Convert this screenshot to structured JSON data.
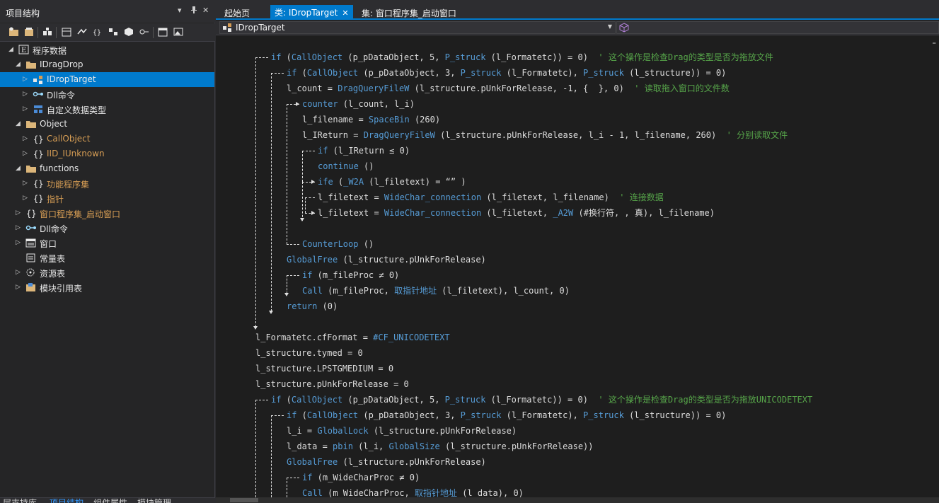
{
  "panel": {
    "title": "项目结构",
    "pin_glyph": "▾",
    "pushpin_glyph": "ꟷ",
    "close_glyph": "✕"
  },
  "tree": [
    {
      "label": "程序数据",
      "level": 0,
      "twist": "◢",
      "icon": "module-e-icon",
      "color": "white"
    },
    {
      "label": "IDragDrop",
      "level": 1,
      "twist": "◢",
      "icon": "folder-icon",
      "color": "white"
    },
    {
      "label": "IDropTarget",
      "level": 2,
      "twist": "▷",
      "icon": "class-icon",
      "color": "white",
      "selected": true
    },
    {
      "label": "Dll命令",
      "level": 2,
      "twist": "▷",
      "icon": "dll-icon",
      "color": "white"
    },
    {
      "label": "自定义数据类型",
      "level": 2,
      "twist": "▷",
      "icon": "datatype-icon",
      "color": "white"
    },
    {
      "label": "Object",
      "level": 1,
      "twist": "◢",
      "icon": "folder-icon",
      "color": "white"
    },
    {
      "label": "CallObject",
      "level": 2,
      "twist": "▷",
      "icon": "braces-icon",
      "color": "orange"
    },
    {
      "label": "IID_IUnknown",
      "level": 2,
      "twist": "▷",
      "icon": "braces-icon",
      "color": "orange"
    },
    {
      "label": "functions",
      "level": 1,
      "twist": "◢",
      "icon": "folder-icon",
      "color": "white"
    },
    {
      "label": "功能程序集",
      "level": 2,
      "twist": "▷",
      "icon": "braces-icon",
      "color": "orange"
    },
    {
      "label": "指针",
      "level": 2,
      "twist": "▷",
      "icon": "braces-icon",
      "color": "orange"
    },
    {
      "label": "窗口程序集_启动窗口",
      "level": 1,
      "twist": "▷",
      "icon": "braces-icon",
      "color": "orange",
      "shift": -1
    },
    {
      "label": "Dll命令",
      "level": 1,
      "twist": "▷",
      "icon": "dll-icon",
      "color": "white",
      "shift": -1
    },
    {
      "label": "窗口",
      "level": 1,
      "twist": "▷",
      "icon": "window-icon",
      "color": "white",
      "shift": -1
    },
    {
      "label": "常量表",
      "level": 1,
      "twist": "",
      "icon": "constants-icon",
      "color": "white",
      "shift": -1
    },
    {
      "label": "资源表",
      "level": 1,
      "twist": "▷",
      "icon": "resources-icon",
      "color": "white",
      "shift": -1
    },
    {
      "label": "模块引用表",
      "level": 1,
      "twist": "▷",
      "icon": "module-ref-icon",
      "color": "white",
      "shift": -1
    }
  ],
  "bottom_tabs": [
    {
      "label": "层支持库",
      "active": false
    },
    {
      "label": "项目结构",
      "active": true
    },
    {
      "label": "组件属性",
      "active": false
    },
    {
      "label": "模块管理",
      "active": false
    }
  ],
  "doc_tabs": [
    {
      "label": "起始页",
      "active": false
    },
    {
      "label": "类: IDropTarget",
      "active": true,
      "close": "✕"
    },
    {
      "label": "集: 窗口程序集_启动窗口",
      "active": false
    }
  ],
  "nav": {
    "class_combo": "IDropTarget",
    "arrow": "▼"
  },
  "right_mark": "⁼",
  "code_lines": [
    [
      [
        "kw",
        "if"
      ],
      [
        "op",
        " ("
      ],
      [
        "kw",
        "CallObject"
      ],
      [
        "op",
        " (p_pDataObject, 5, "
      ],
      [
        "kw",
        "P_struck"
      ],
      [
        "op",
        " (l_Formatetc)) = 0)  "
      ],
      [
        "cm",
        "' 这个操作是检查Drag的类型是否为拖放文件"
      ]
    ],
    [
      [
        "kw",
        "if"
      ],
      [
        "op",
        " ("
      ],
      [
        "kw",
        "CallObject"
      ],
      [
        "op",
        " (p_pDataObject, 3, "
      ],
      [
        "kw",
        "P_struck"
      ],
      [
        "op",
        " (l_Formatetc), "
      ],
      [
        "kw",
        "P_struck"
      ],
      [
        "op",
        " (l_structure)) = 0)"
      ]
    ],
    [
      [
        "var",
        "l_count = "
      ],
      [
        "kw",
        "DragQueryFileW"
      ],
      [
        "op",
        " (l_structure.pUnkForRelease, -1, {  }, 0)  "
      ],
      [
        "cm",
        "' 读取拖入窗口的文件数"
      ]
    ],
    [
      [
        "kw",
        "counter"
      ],
      [
        "op",
        " (l_count, l_i)"
      ]
    ],
    [
      [
        "var",
        "l_filename = "
      ],
      [
        "kw",
        "SpaceBin"
      ],
      [
        "op",
        " (260)"
      ]
    ],
    [
      [
        "var",
        "l_IReturn = "
      ],
      [
        "kw",
        "DragQueryFileW"
      ],
      [
        "op",
        " (l_structure.pUnkForRelease, l_i - 1, l_filename, 260)  "
      ],
      [
        "cm",
        "' 分别读取文件"
      ]
    ],
    [
      [
        "kw",
        "if"
      ],
      [
        "op",
        " (l_IReturn ≤ 0)"
      ]
    ],
    [
      [
        "kw",
        "continue"
      ],
      [
        "op",
        " ()"
      ]
    ],
    [
      [
        "kw",
        "ife"
      ],
      [
        "op",
        " ("
      ],
      [
        "kw",
        "_W2A"
      ],
      [
        "op",
        " (l_filetext) = “” )"
      ]
    ],
    [
      [
        "var",
        "l_filetext = "
      ],
      [
        "kw",
        "WideChar_connection"
      ],
      [
        "op",
        " (l_filetext, l_filename)  "
      ],
      [
        "cm",
        "' 连接数据"
      ]
    ],
    [
      [
        "var",
        "l_filetext = "
      ],
      [
        "kw",
        "WideChar_connection"
      ],
      [
        "op",
        " (l_filetext, "
      ],
      [
        "kw",
        "_A2W"
      ],
      [
        "op",
        " (#换行符, , 真), l_filename)"
      ]
    ],
    [],
    [
      [
        "kw",
        "CounterLoop"
      ],
      [
        "op",
        " ()"
      ]
    ],
    [
      [
        "kw",
        "GlobalFree"
      ],
      [
        "op",
        " (l_structure.pUnkForRelease)"
      ]
    ],
    [
      [
        "kw",
        "if"
      ],
      [
        "op",
        " (m_fileProc ≠ 0)"
      ]
    ],
    [
      [
        "kw",
        "Call"
      ],
      [
        "op",
        " (m_fileProc, "
      ],
      [
        "kw",
        "取指针地址"
      ],
      [
        "op",
        " (l_filetext), l_count, 0)"
      ]
    ],
    [
      [
        "kw",
        "return"
      ],
      [
        "op",
        " (0)"
      ]
    ],
    [],
    [
      [
        "var",
        "l_Formatetc.cfFormat = "
      ],
      [
        "kw",
        "#CF_UNICODETEXT"
      ]
    ],
    [
      [
        "var",
        "l_structure.tymed = 0"
      ]
    ],
    [
      [
        "var",
        "l_structure.LPSTGMEDIUM = 0"
      ]
    ],
    [
      [
        "var",
        "l_structure.pUnkForRelease = 0"
      ]
    ],
    [
      [
        "kw",
        "if"
      ],
      [
        "op",
        " ("
      ],
      [
        "kw",
        "CallObject"
      ],
      [
        "op",
        " (p_pDataObject, 5, "
      ],
      [
        "kw",
        "P_struck"
      ],
      [
        "op",
        " (l_Formatetc)) = 0)  "
      ],
      [
        "cm",
        "' 这个操作是检查Drag的类型是否为拖放UNICODETEXT"
      ]
    ],
    [
      [
        "kw",
        "if"
      ],
      [
        "op",
        " ("
      ],
      [
        "kw",
        "CallObject"
      ],
      [
        "op",
        " (p_pDataObject, 3, "
      ],
      [
        "kw",
        "P_struck"
      ],
      [
        "op",
        " (l_Formatetc), "
      ],
      [
        "kw",
        "P_struck"
      ],
      [
        "op",
        " (l_structure)) = 0)"
      ]
    ],
    [
      [
        "var",
        "l_i = "
      ],
      [
        "kw",
        "GlobalLock"
      ],
      [
        "op",
        " (l_structure.pUnkForRelease)"
      ]
    ],
    [
      [
        "var",
        "l_data = "
      ],
      [
        "kw",
        "pbin"
      ],
      [
        "op",
        " (l_i, "
      ],
      [
        "kw",
        "GlobalSize"
      ],
      [
        "op",
        " (l_structure.pUnkForRelease))"
      ]
    ],
    [
      [
        "kw",
        "GlobalFree"
      ],
      [
        "op",
        " (l_structure.pUnkForRelease)"
      ]
    ],
    [
      [
        "kw",
        "if"
      ],
      [
        "op",
        " (m_WideCharProc ≠ 0)"
      ]
    ],
    [
      [
        "kw",
        "Call"
      ],
      [
        "op",
        " (m_WideCharProc, "
      ],
      [
        "kw",
        "取指针地址"
      ],
      [
        "op",
        " (l_data), 0)"
      ]
    ]
  ]
}
